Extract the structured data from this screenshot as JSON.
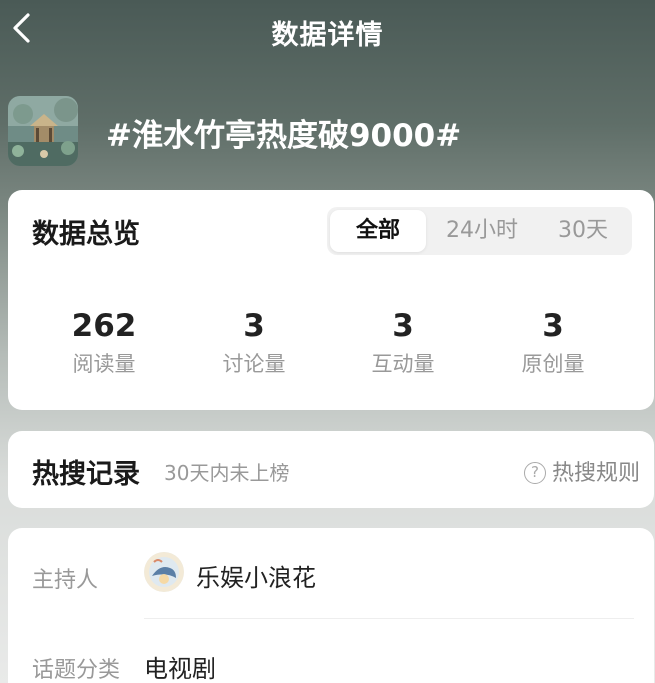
{
  "nav": {
    "title": "数据详情"
  },
  "topic": {
    "title": "#淮水竹亭热度破9000#"
  },
  "overview": {
    "title": "数据总览",
    "tabs": [
      {
        "label": "全部",
        "active": true
      },
      {
        "label": "24小时",
        "active": false
      },
      {
        "label": "30天",
        "active": false
      }
    ],
    "stats": [
      {
        "value": "262",
        "label": "阅读量"
      },
      {
        "value": "3",
        "label": "讨论量"
      },
      {
        "value": "3",
        "label": "互动量"
      },
      {
        "value": "3",
        "label": "原创量"
      }
    ]
  },
  "hot_search": {
    "title": "热搜记录",
    "subtitle": "30天内未上榜",
    "rule_label": "热搜规则",
    "rule_icon": "question-circle-icon"
  },
  "info": {
    "host_label": "主持人",
    "host_name": "乐娱小浪花",
    "category_label": "话题分类",
    "category_value": "电视剧"
  }
}
